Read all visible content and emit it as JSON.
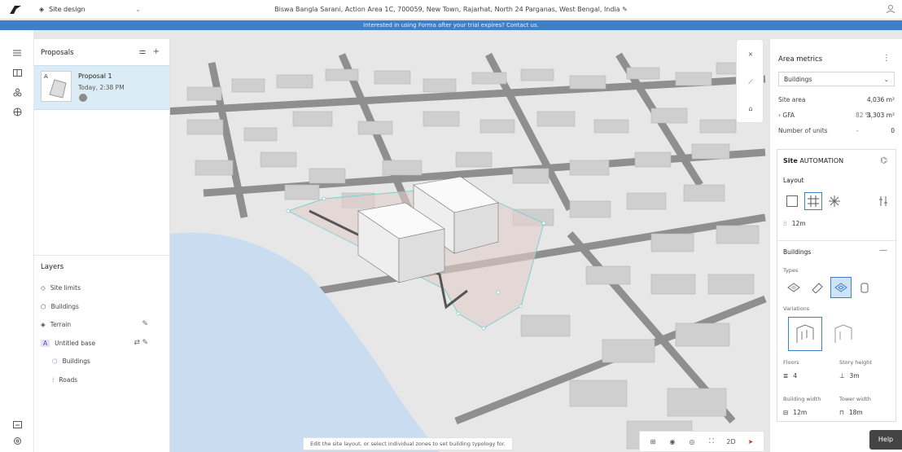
{
  "header": {
    "mode_label": "Site design",
    "address": "Biswa Bangla Sarani, Action Area 1C, 700059, New Town, Rajarhat, North 24 Parganas, West Bengal, India"
  },
  "banner": {
    "text": "Interested in using Forma after your trial expires? Contact us."
  },
  "proposals": {
    "title": "Proposals",
    "items": [
      {
        "badge": "A",
        "name": "Proposal 1",
        "time": "Today, 2:38 PM"
      }
    ]
  },
  "layers": {
    "title": "Layers",
    "items": [
      "Site limits",
      "Buildings",
      "Terrain"
    ],
    "base": {
      "badge": "A",
      "label": "Untitled base",
      "children": [
        "Buildings",
        "Roads"
      ]
    }
  },
  "metrics": {
    "title": "Area metrics",
    "selector": "Buildings",
    "site_area_label": "Site area",
    "site_area_value": "4,036 m²",
    "gfa_label": "GFA",
    "gfa_pct": "82 %",
    "gfa_value": "3,303 m²",
    "units_label": "Number of units",
    "units_dash": "-",
    "units_value": "0"
  },
  "automation": {
    "title_bold": "Site",
    "title_rest": "AUTOMATION",
    "layout_label": "Layout",
    "grid_value": "12m",
    "buildings_label": "Buildings",
    "types_label": "Types",
    "variations_label": "Variations",
    "floors_label": "Floors",
    "floors_value": "4",
    "story_height_label": "Story height",
    "story_height_value": "3m",
    "building_width_label": "Building width",
    "building_width_value": "12m",
    "tower_width_label": "Tower width",
    "tower_width_value": "18m"
  },
  "bottom": {
    "hint": "Edit the site layout, or select individual zones to set building typology for.",
    "view_2d": "2D",
    "help": "Help"
  }
}
